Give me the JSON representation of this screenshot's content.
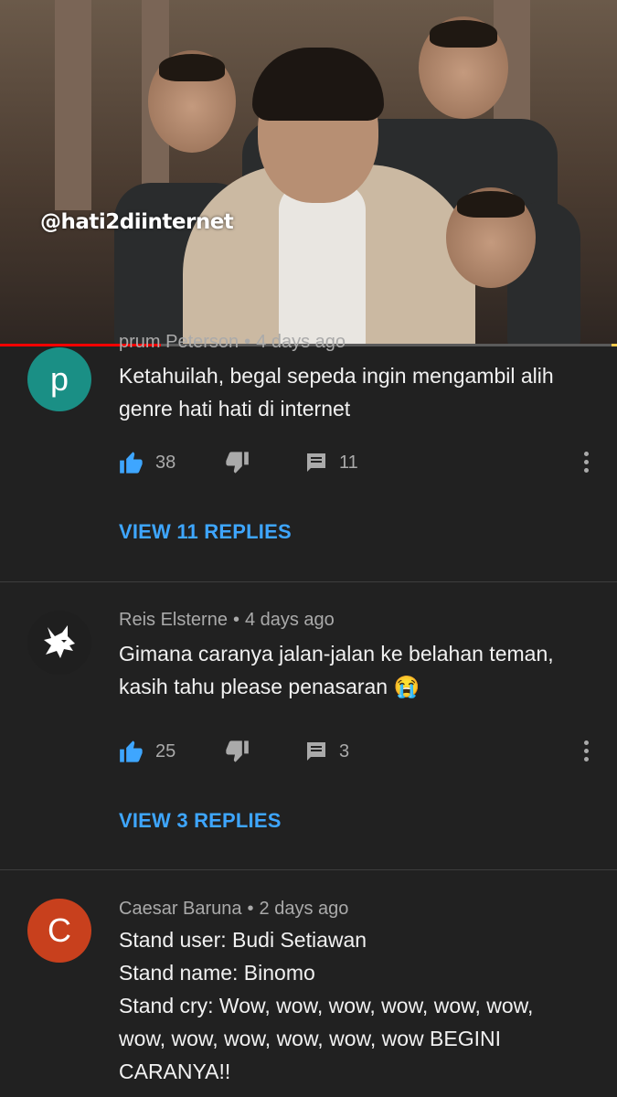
{
  "video": {
    "watermark": "@hati2diinternet",
    "progress": 0.26,
    "progress_color": "#ff0000"
  },
  "comments": [
    {
      "author": "prum Peterson",
      "time": "4 days ago",
      "avatar_letter": "p",
      "avatar_color": "#1a8f85",
      "text": "Ketahuilah, begal sepeda ingin mengambil alih genre hati hati di internet",
      "likes": "38",
      "replies_count": "11",
      "view_replies": "VIEW 11 REPLIES"
    },
    {
      "author": "Reis Elsterne",
      "time": "4 days ago",
      "avatar_letter": "",
      "avatar_color": "#1f1f1f",
      "text_line1": "Gimana caranya jalan-jalan ke belahan teman,",
      "text_line2": "kasih tahu please penasaran",
      "emoji": "😭",
      "likes": "25",
      "replies_count": "3",
      "view_replies": "VIEW 3 REPLIES"
    },
    {
      "author": "Caesar Baruna",
      "time": "2 days ago",
      "avatar_letter": "C",
      "avatar_color": "#c8401d",
      "lines": [
        "Stand user: Budi Setiawan",
        "Stand name: Binomo",
        "Stand cry: Wow, wow, wow, wow, wow, wow,",
        "wow, wow, wow, wow, wow, wow BEGINI",
        "CARANYA!!"
      ]
    }
  ],
  "colors": {
    "background": "#212121",
    "link": "#3ea6ff",
    "meta": "#aaaaaa"
  },
  "icons": {
    "like": "thumbs-up-icon",
    "dislike": "thumbs-down-icon",
    "reply": "comment-icon",
    "more": "more-vertical-icon"
  }
}
